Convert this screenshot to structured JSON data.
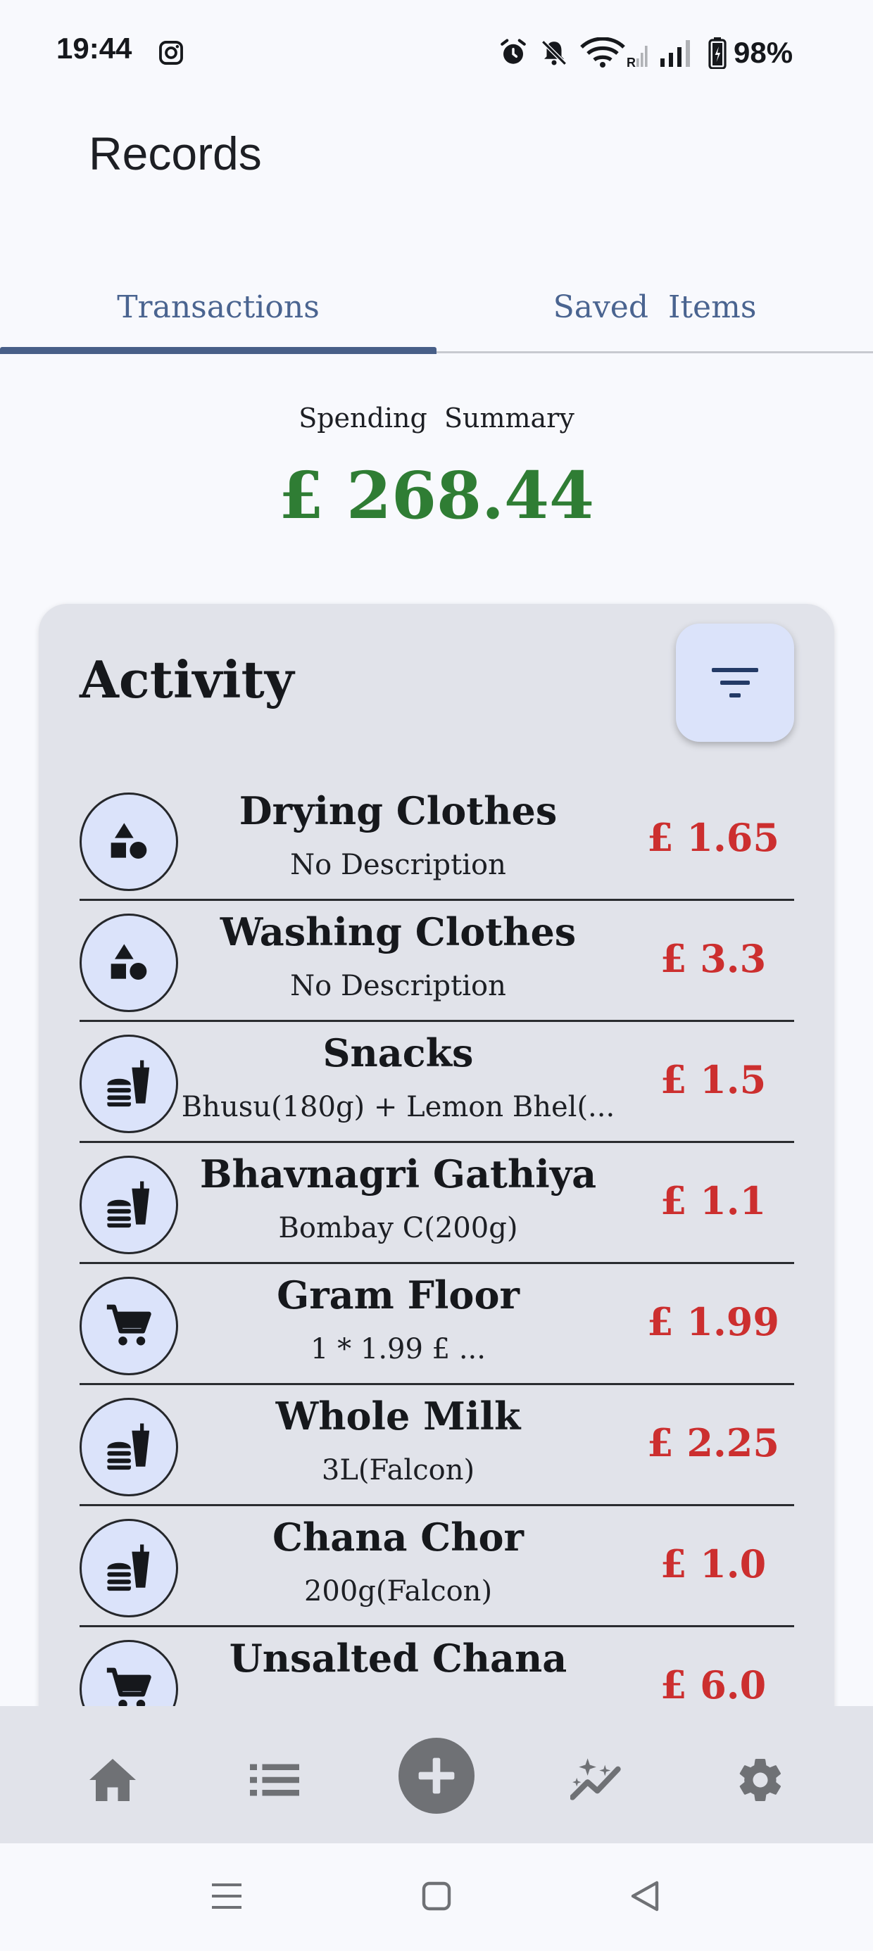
{
  "status_bar": {
    "time": "19:44",
    "battery": "98%",
    "icons": [
      "instagram-icon",
      "alarm-icon",
      "bell-off-icon",
      "wifi-icon",
      "signal-icon",
      "battery-icon"
    ]
  },
  "page": {
    "title": "Records"
  },
  "tabs": [
    {
      "label": "Transactions",
      "selected": true
    },
    {
      "label": "Saved  Items",
      "selected": false
    }
  ],
  "summary": {
    "label": "Spending  Summary",
    "amount": "£ 268.44",
    "color": "#2f7d34"
  },
  "activity": {
    "title": "Activity",
    "filter_icon": "filter-icon",
    "amount_color": "#cc2f2f",
    "items": [
      {
        "icon": "shapes-icon",
        "title": "Drying Clothes",
        "description": "No Description",
        "amount": "£ 1.65"
      },
      {
        "icon": "shapes-icon",
        "title": "Washing Clothes",
        "description": "No Description",
        "amount": "£ 3.3"
      },
      {
        "icon": "fastfood-icon",
        "title": "Snacks",
        "description": "Bhusu(180g) + Lemon Bhel(...",
        "amount": "£ 1.5"
      },
      {
        "icon": "fastfood-icon",
        "title": "Bhavnagri Gathiya",
        "description": "Bombay C(200g)",
        "amount": "£ 1.1"
      },
      {
        "icon": "cart-icon",
        "title": "Gram Floor",
        "description": "1 * 1.99 £ ...",
        "amount": "£ 1.99"
      },
      {
        "icon": "fastfood-icon",
        "title": "Whole Milk",
        "description": "3L(Falcon)",
        "amount": "£ 2.25"
      },
      {
        "icon": "fastfood-icon",
        "title": "Chana Chor",
        "description": "200g(Falcon)",
        "amount": "£ 1.0"
      },
      {
        "icon": "cart-icon",
        "title": "Unsalted Chana",
        "description": "",
        "amount": "£ 6.0"
      }
    ]
  },
  "bottom_nav": {
    "items": [
      "home-icon",
      "list-icon",
      "add-icon",
      "insights-icon",
      "settings-icon"
    ]
  },
  "system_nav": {
    "items": [
      "recents-icon",
      "home-square-icon",
      "back-icon"
    ]
  }
}
